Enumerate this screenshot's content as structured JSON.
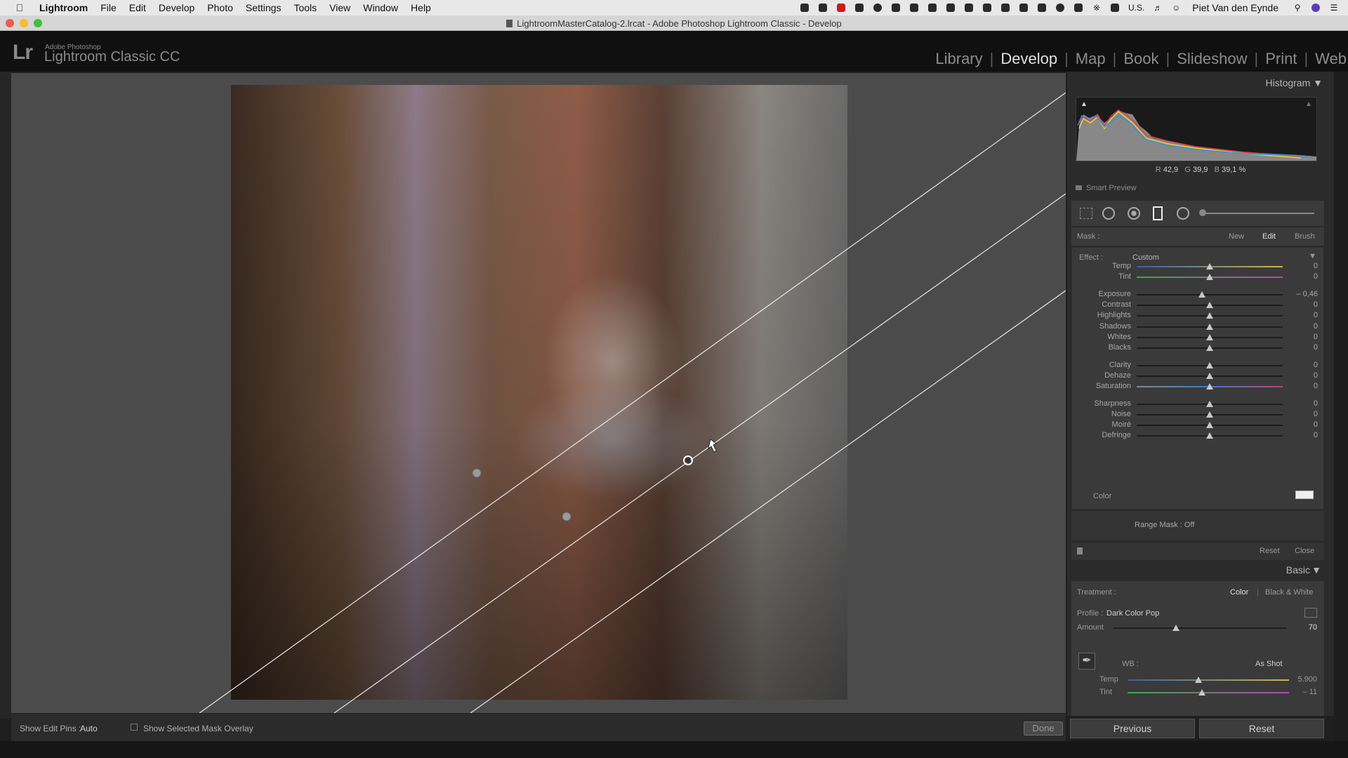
{
  "menubar": {
    "items": [
      "Lightroom",
      "File",
      "Edit",
      "Develop",
      "Photo",
      "Settings",
      "Tools",
      "View",
      "Window",
      "Help"
    ],
    "lang": "U.S.",
    "user": "Piet Van den Eynde"
  },
  "window": {
    "title": "LightroomMasterCatalog-2.lrcat - Adobe Photoshop Lightroom Classic - Develop"
  },
  "brand": {
    "subtitle": "Adobe Photoshop",
    "name": "Lightroom Classic CC",
    "mark": "Lr"
  },
  "modules": [
    "Library",
    "Develop",
    "Map",
    "Book",
    "Slideshow",
    "Print",
    "Web"
  ],
  "histogram": {
    "title": "Histogram",
    "r_label": "R",
    "r_value": "42,9",
    "g_label": "G",
    "g_value": "39,9",
    "b_label": "B",
    "b_value": "39,1 %",
    "smart_preview": "Smart Preview"
  },
  "mask": {
    "label": "Mask :",
    "new": "New",
    "edit": "Edit",
    "brush": "Brush",
    "effect_label": "Effect :",
    "effect_value": "Custom",
    "range_mask": "Range Mask : Off",
    "reset": "Reset",
    "close": "Close"
  },
  "sliders": [
    {
      "label": "Temp",
      "value": "0",
      "pos": 0.5,
      "type": "temp"
    },
    {
      "label": "Tint",
      "value": "0",
      "pos": 0.5,
      "type": "tint"
    },
    {
      "label": "Exposure",
      "value": "– 0,46",
      "pos": 0.445,
      "type": "plain"
    },
    {
      "label": "Contrast",
      "value": "0",
      "pos": 0.5,
      "type": "plain"
    },
    {
      "label": "Highlights",
      "value": "0",
      "pos": 0.5,
      "type": "plain"
    },
    {
      "label": "Shadows",
      "value": "0",
      "pos": 0.5,
      "type": "plain"
    },
    {
      "label": "Whites",
      "value": "0",
      "pos": 0.5,
      "type": "plain"
    },
    {
      "label": "Blacks",
      "value": "0",
      "pos": 0.5,
      "type": "plain"
    },
    {
      "label": "Clarity",
      "value": "0",
      "pos": 0.5,
      "type": "plain"
    },
    {
      "label": "Dehaze",
      "value": "0",
      "pos": 0.5,
      "type": "plain"
    },
    {
      "label": "Saturation",
      "value": "0",
      "pos": 0.5,
      "type": "sat"
    },
    {
      "label": "Sharpness",
      "value": "0",
      "pos": 0.5,
      "type": "plain"
    },
    {
      "label": "Noise",
      "value": "0",
      "pos": 0.5,
      "type": "plain"
    },
    {
      "label": "Moiré",
      "value": "0",
      "pos": 0.5,
      "type": "plain"
    },
    {
      "label": "Defringe",
      "value": "0",
      "pos": 0.5,
      "type": "plain"
    }
  ],
  "color_label": "Color",
  "basic": {
    "title": "Basic",
    "treatment_label": "Treatment :",
    "color": "Color",
    "bw": "Black & White",
    "profile_label": "Profile :",
    "profile_value": "Dark Color Pop",
    "amount_label": "Amount",
    "amount_value": "70",
    "amount_pos": 0.36,
    "wb_label": "WB :",
    "wb_value": "As Shot",
    "temp_label": "Temp",
    "temp_value": "5.900",
    "temp_pos": 0.44,
    "tint_label": "Tint",
    "tint_value": "– 11",
    "tint_pos": 0.46
  },
  "toolbar": {
    "show_pins_label": "Show Edit Pins :",
    "show_pins_value": "Auto",
    "show_overlay_label": "Show Selected Mask Overlay",
    "done": "Done"
  },
  "nav": {
    "previous": "Previous",
    "reset": "Reset"
  },
  "colors": {
    "accent": "#e0e0e0",
    "panel_bg": "#3a3a3a"
  }
}
